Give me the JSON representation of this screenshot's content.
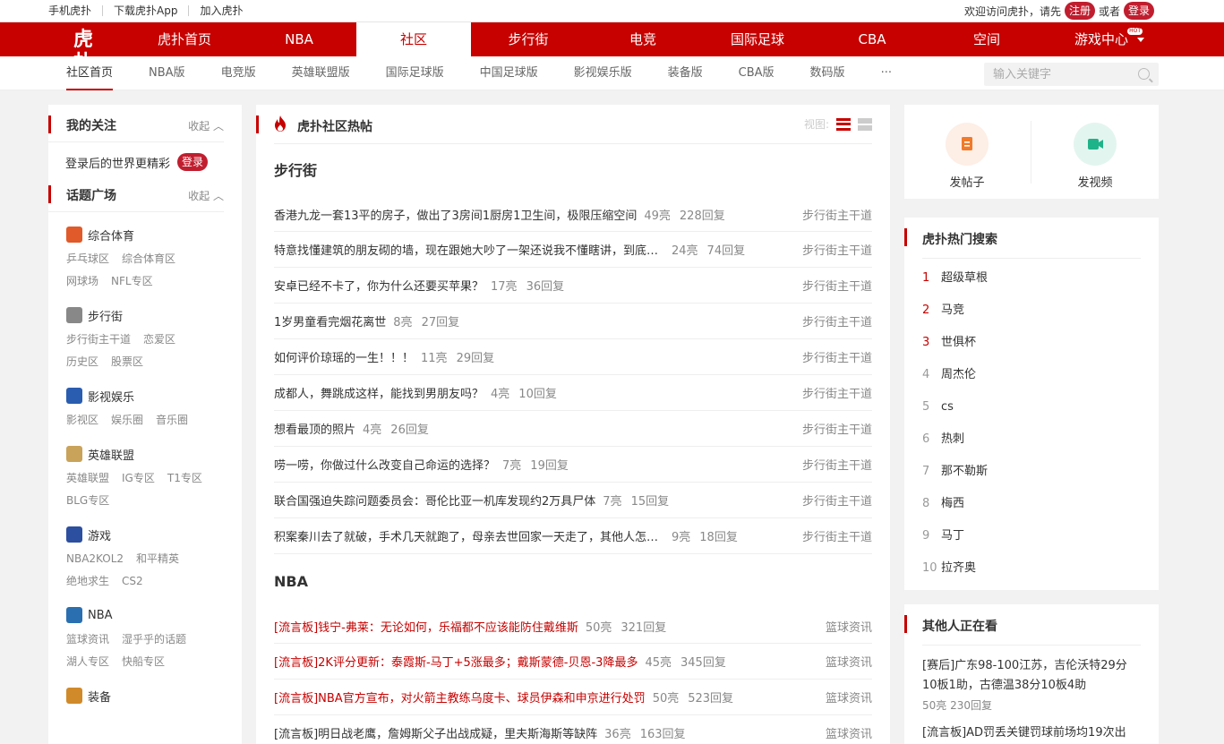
{
  "topbar": {
    "links": [
      "手机虎扑",
      "下载虎扑App",
      "加入虎扑"
    ],
    "welcome": "欢迎访问虎扑，请先",
    "register": "注册",
    "or": "或者",
    "login": "登录"
  },
  "mainnav": {
    "logo": "虎扑",
    "items": [
      "虎扑首页",
      "NBA",
      "社区",
      "步行街",
      "电竞",
      "国际足球",
      "CBA",
      "空间",
      "游戏中心"
    ],
    "active_index": 2,
    "hot_badge": "HOT"
  },
  "subnav": {
    "items": [
      "社区首页",
      "NBA版",
      "电竞版",
      "英雄联盟版",
      "国际足球版",
      "中国足球版",
      "影视娱乐版",
      "装备版",
      "CBA版",
      "数码版",
      "···"
    ],
    "search_placeholder": "输入关键字"
  },
  "left": {
    "follow_title": "我的关注",
    "collapse": "收起",
    "login_tip": "登录后的世界更精彩",
    "login_btn": "登录",
    "topics_title": "话题广场",
    "topics": [
      {
        "name": "综合体育",
        "icon": "sports-icon",
        "color": "#e05a2a",
        "subs": [
          "乒乓球区",
          "综合体育区",
          "网球场",
          "NFL专区"
        ]
      },
      {
        "name": "步行街",
        "icon": "street-icon",
        "color": "#888888",
        "subs": [
          "步行街主干道",
          "恋爱区",
          "历史区",
          "股票区"
        ]
      },
      {
        "name": "影视娱乐",
        "icon": "popcorn-icon",
        "color": "#2a5db0",
        "subs": [
          "影视区",
          "娱乐圈",
          "音乐圈"
        ]
      },
      {
        "name": "英雄联盟",
        "icon": "lol-icon",
        "color": "#c9a35a",
        "subs": [
          "英雄联盟",
          "IG专区",
          "T1专区",
          "BLG专区"
        ]
      },
      {
        "name": "游戏",
        "icon": "gamepad-icon",
        "color": "#2d4fa0",
        "subs": [
          "NBA2KOL2",
          "和平精英",
          "绝地求生",
          "CS2"
        ]
      },
      {
        "name": "NBA",
        "icon": "nba-icon",
        "color": "#2a6fb0",
        "subs": [
          "篮球资讯",
          "湿乎乎的话题",
          "湖人专区",
          "快船专区"
        ]
      },
      {
        "name": "装备",
        "icon": "gear-bag-icon",
        "color": "#d08a2a",
        "subs": []
      }
    ]
  },
  "center": {
    "title": "虎扑社区热帖",
    "view_label": "视图:",
    "boards": [
      {
        "name": "步行街",
        "posts": [
          {
            "title": "香港九龙一套13平的房子，做出了3房间1厨房1卫生间，极限压缩空间",
            "lights": "49亮",
            "replies": "228回复",
            "source": "步行街主干道",
            "red": false
          },
          {
            "title": "特意找懂建筑的朋友砌的墙，现在跟她大吵了一架还说我不懂瞎讲，到底谁对",
            "lights": "24亮",
            "replies": "74回复",
            "source": "步行街主干道",
            "red": false
          },
          {
            "title": "安卓已经不卡了，你为什么还要买苹果？",
            "lights": "17亮",
            "replies": "36回复",
            "source": "步行街主干道",
            "red": false
          },
          {
            "title": "1岁男童看完烟花离世",
            "lights": "8亮",
            "replies": "27回复",
            "source": "步行街主干道",
            "red": false
          },
          {
            "title": "如何评价琼瑶的一生！！！",
            "lights": "11亮",
            "replies": "29回复",
            "source": "步行街主干道",
            "red": false
          },
          {
            "title": "成都人，舞跳成这样，能找到男朋友吗？",
            "lights": "4亮",
            "replies": "10回复",
            "source": "步行街主干道",
            "red": false
          },
          {
            "title": "想看最顶的照片",
            "lights": "4亮",
            "replies": "26回复",
            "source": "步行街主干道",
            "red": false
          },
          {
            "title": "唠一唠，你做过什么改变自己命运的选择？",
            "lights": "7亮",
            "replies": "19回复",
            "source": "步行街主干道",
            "red": false
          },
          {
            "title": "联合国强迫失踪问题委员会：哥伦比亚一机库发现约2万具尸体",
            "lights": "7亮",
            "replies": "15回复",
            "source": "步行街主干道",
            "red": false
          },
          {
            "title": "积案秦川去了就破，手术几天就跑了，母亲去世回家一天走了，其他人怎么看",
            "lights": "9亮",
            "replies": "18回复",
            "source": "步行街主干道",
            "red": false
          }
        ]
      },
      {
        "name": "NBA",
        "posts": [
          {
            "title": "[流言板]钱宁-弗莱：无论如何，乐福都不应该能防住戴维斯",
            "lights": "50亮",
            "replies": "321回复",
            "source": "篮球资讯",
            "red": true
          },
          {
            "title": "[流言板]2K评分更新：泰霞斯-马丁+5涨最多；戴斯蒙德-贝恩-3降最多",
            "lights": "45亮",
            "replies": "345回复",
            "source": "篮球资讯",
            "red": true
          },
          {
            "title": "[流言板]NBA官方宣布，对火箭主教练乌度卡、球员伊森和申京进行处罚",
            "lights": "50亮",
            "replies": "523回复",
            "source": "篮球资讯",
            "red": true
          },
          {
            "title": "[流言板]明日战老鹰，詹姆斯父子出战成疑，里夫斯海斯等缺阵",
            "lights": "36亮",
            "replies": "163回复",
            "source": "篮球资讯",
            "red": false
          }
        ]
      }
    ]
  },
  "right": {
    "post_label": "发帖子",
    "video_label": "发视频",
    "hot_title": "虎扑热门搜索",
    "hot": [
      "超级草根",
      "马竞",
      "世俱杯",
      "周杰伦",
      "cs",
      "热刺",
      "那不勒斯",
      "梅西",
      "马丁",
      "拉齐奥"
    ],
    "watch_title": "其他人正在看",
    "watch": [
      {
        "title": "[赛后]广东98-100江苏，吉伦沃特29分10板1助，古德温38分10板4助",
        "meta": "50亮 230回复"
      },
      {
        "title": "[流言板]AD罚丢关键罚球前场均19次出",
        "meta": ""
      }
    ]
  }
}
